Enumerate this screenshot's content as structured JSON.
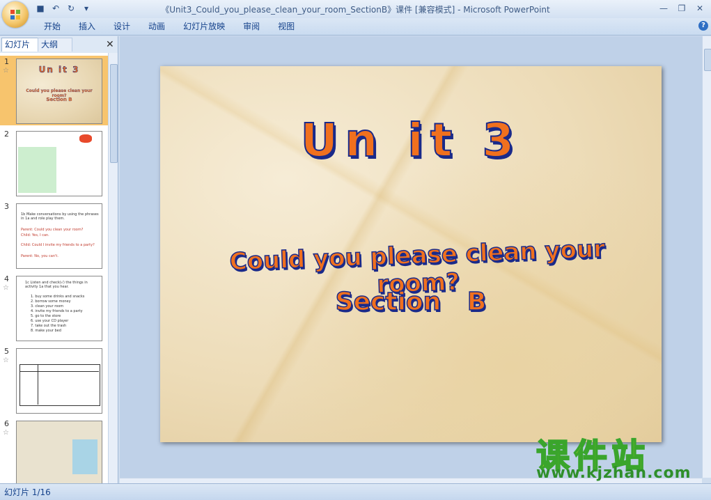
{
  "window": {
    "title": "《Unit3_Could_you_please_clean_your_room_SectionB》课件 [兼容模式] - Microsoft PowerPoint"
  },
  "ribbon": {
    "tabs": [
      "开始",
      "插入",
      "设计",
      "动画",
      "幻灯片放映",
      "审阅",
      "视图"
    ]
  },
  "left_pane": {
    "tabs": [
      "幻灯片",
      "大纲"
    ],
    "thumbnails": [
      {
        "number": "1",
        "title": "Un it 3",
        "subtitle": "Could you please clean your room?",
        "subtitle2": "Section B"
      },
      {
        "number": "2"
      },
      {
        "number": "3",
        "lines": [
          "1b Make conversations by using the phrases in 1a and role play them.",
          "Parent: Could you clean your room?",
          "Child: Yes, I can.",
          "Child: Could I invite my friends to a party?",
          "Parent: No, you can't."
        ]
      },
      {
        "number": "4",
        "lines": [
          "1c Listen and check(√) the things in activity 1a that you hear.",
          "1. buy some drinks and snacks",
          "2. borrow some money",
          "3. clean your room",
          "4. invite my friends to a party",
          "5. go to the store",
          "6. use your CD player",
          "7. take out the trash",
          "8. make your bed"
        ]
      },
      {
        "number": "5"
      },
      {
        "number": "6"
      }
    ]
  },
  "slide": {
    "title": "Un it 3",
    "subtitle": "Could you please clean your room?",
    "subtitle2": "Section   B"
  },
  "watermark": {
    "cn": "课件站",
    "url": "www.kjzhan.com"
  },
  "status": {
    "slide_counter": "幻灯片 1/16"
  }
}
